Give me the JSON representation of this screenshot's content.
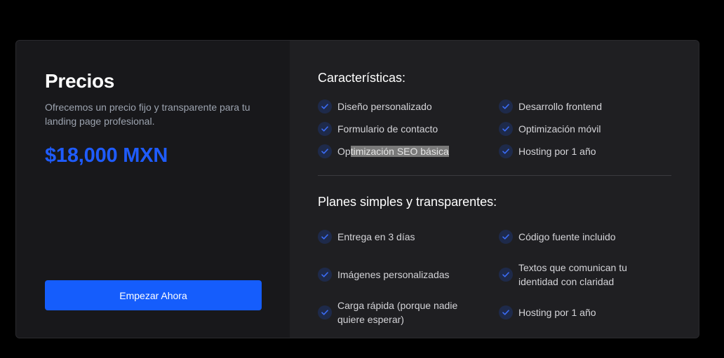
{
  "pricing": {
    "title": "Precios",
    "description": "Ofrecemos un precio fijo y transparente para tu landing page profesional.",
    "price": "$18,000 MXN",
    "cta_label": "Empezar Ahora"
  },
  "features": {
    "title": "Características:",
    "items": [
      "Diseño personalizado",
      "Desarrollo frontend",
      "Formulario de contacto",
      "Optimización móvil",
      "Optimización SEO básica",
      "Hosting por 1 año"
    ],
    "highlight_prefix": "Op",
    "highlight_rest": "timización SEO básica"
  },
  "plans": {
    "title": "Planes simples y transparentes:",
    "items": [
      "Entrega en 3 días",
      "Código fuente incluido",
      "Imágenes personalizadas",
      "Textos que comunican tu identidad con claridad",
      "Carga rápida (porque nadie quiere esperar)",
      "Hosting por 1 año"
    ]
  },
  "colors": {
    "accent": "#155dfc",
    "price": "#1f5cff",
    "check_bg": "#1e2a4a",
    "check_mark": "#3b6cf5"
  },
  "icons": {
    "check": "check-circle-icon"
  }
}
